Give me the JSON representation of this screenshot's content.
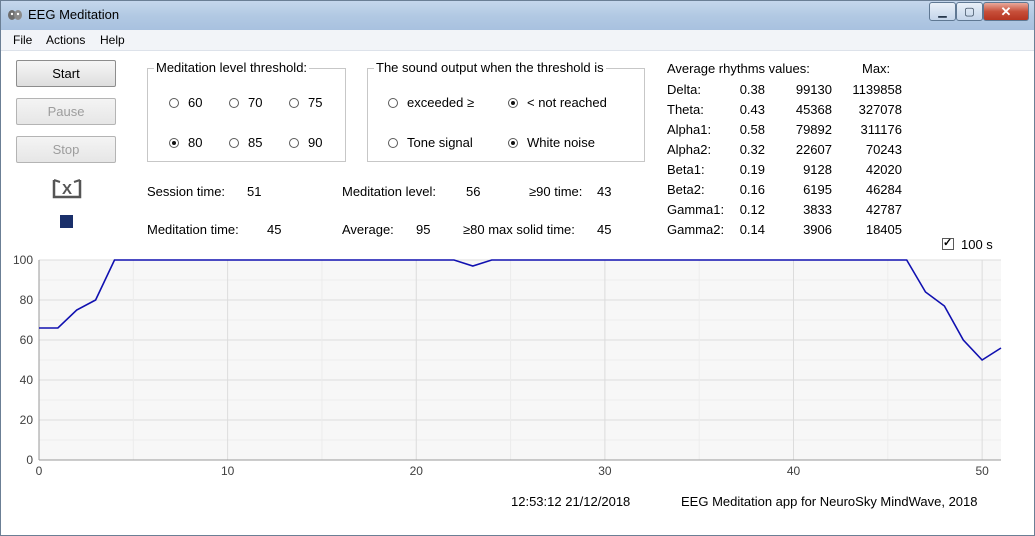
{
  "window": {
    "title": "EEG Meditation",
    "controls": [
      "minimize",
      "maximize",
      "close"
    ]
  },
  "menu": [
    "File",
    "Actions",
    "Help"
  ],
  "buttons": {
    "start": "Start",
    "pause": "Pause",
    "stop": "Stop"
  },
  "threshold": {
    "legend": "Meditation level threshold:",
    "options": [
      {
        "label": "60",
        "selected": false
      },
      {
        "label": "70",
        "selected": false
      },
      {
        "label": "75",
        "selected": false
      },
      {
        "label": "80",
        "selected": true
      },
      {
        "label": "85",
        "selected": false
      },
      {
        "label": "90",
        "selected": false
      }
    ]
  },
  "sound": {
    "legend": "The sound output when the threshold is",
    "options": [
      {
        "label": "exceeded ≥",
        "selected": false
      },
      {
        "label": "< not reached",
        "selected": true
      },
      {
        "label": "Tone signal",
        "selected": false
      },
      {
        "label": "White noise",
        "selected": true
      }
    ]
  },
  "stats": {
    "session_time_label": "Session time:",
    "session_time": "51",
    "meditation_time_label": "Meditation time:",
    "meditation_time": "45",
    "meditation_level_label": "Meditation level:",
    "meditation_level": "56",
    "average_label": "Average:",
    "average": "95",
    "ge90_label": "≥90 time:",
    "ge90": "43",
    "ge80_label": "≥80 max solid time:",
    "ge80": "45"
  },
  "rhythms": {
    "header": "Average rhythms values:",
    "max_header": "Max:",
    "rows": [
      {
        "name": "Delta:",
        "ratio": "0.38",
        "value": "99130",
        "max": "1139858"
      },
      {
        "name": "Theta:",
        "ratio": "0.43",
        "value": "45368",
        "max": "327078"
      },
      {
        "name": "Alpha1:",
        "ratio": "0.58",
        "value": "79892",
        "max": "311176"
      },
      {
        "name": "Alpha2:",
        "ratio": "0.32",
        "value": "22607",
        "max": "70243"
      },
      {
        "name": "Beta1:",
        "ratio": "0.19",
        "value": "9128",
        "max": "42020"
      },
      {
        "name": "Beta2:",
        "ratio": "0.16",
        "value": "6195",
        "max": "46284"
      },
      {
        "name": "Gamma1:",
        "ratio": "0.12",
        "value": "3833",
        "max": "42787"
      },
      {
        "name": "Gamma2:",
        "ratio": "0.14",
        "value": "3906",
        "max": "18405"
      }
    ]
  },
  "window_checkbox": {
    "label": "100 s",
    "checked": true
  },
  "status": {
    "timestamp": "12:53:12  21/12/2018",
    "app": "EEG Meditation app for NeuroSky MindWave, 2018"
  },
  "icons": {
    "app": "brain-icon",
    "emblem": "meditation-icon",
    "indicator": "status-square-icon"
  },
  "colors": {
    "line": "#1010b0",
    "indicator": "#1a2f6a",
    "grid": "#e4e4e4"
  },
  "chart_data": {
    "type": "line",
    "xlim": [
      0,
      51
    ],
    "ylim": [
      0,
      100
    ],
    "x_ticks": [
      0,
      10,
      20,
      30,
      40,
      50
    ],
    "y_ticks": [
      0,
      20,
      40,
      60,
      80,
      100
    ],
    "grid": true,
    "x": [
      0,
      1,
      2,
      3,
      4,
      22,
      23,
      24,
      46,
      47,
      48,
      49,
      50,
      51
    ],
    "values": [
      66,
      66,
      75,
      80,
      100,
      100,
      97,
      100,
      100,
      84,
      77,
      60,
      50,
      56
    ]
  }
}
